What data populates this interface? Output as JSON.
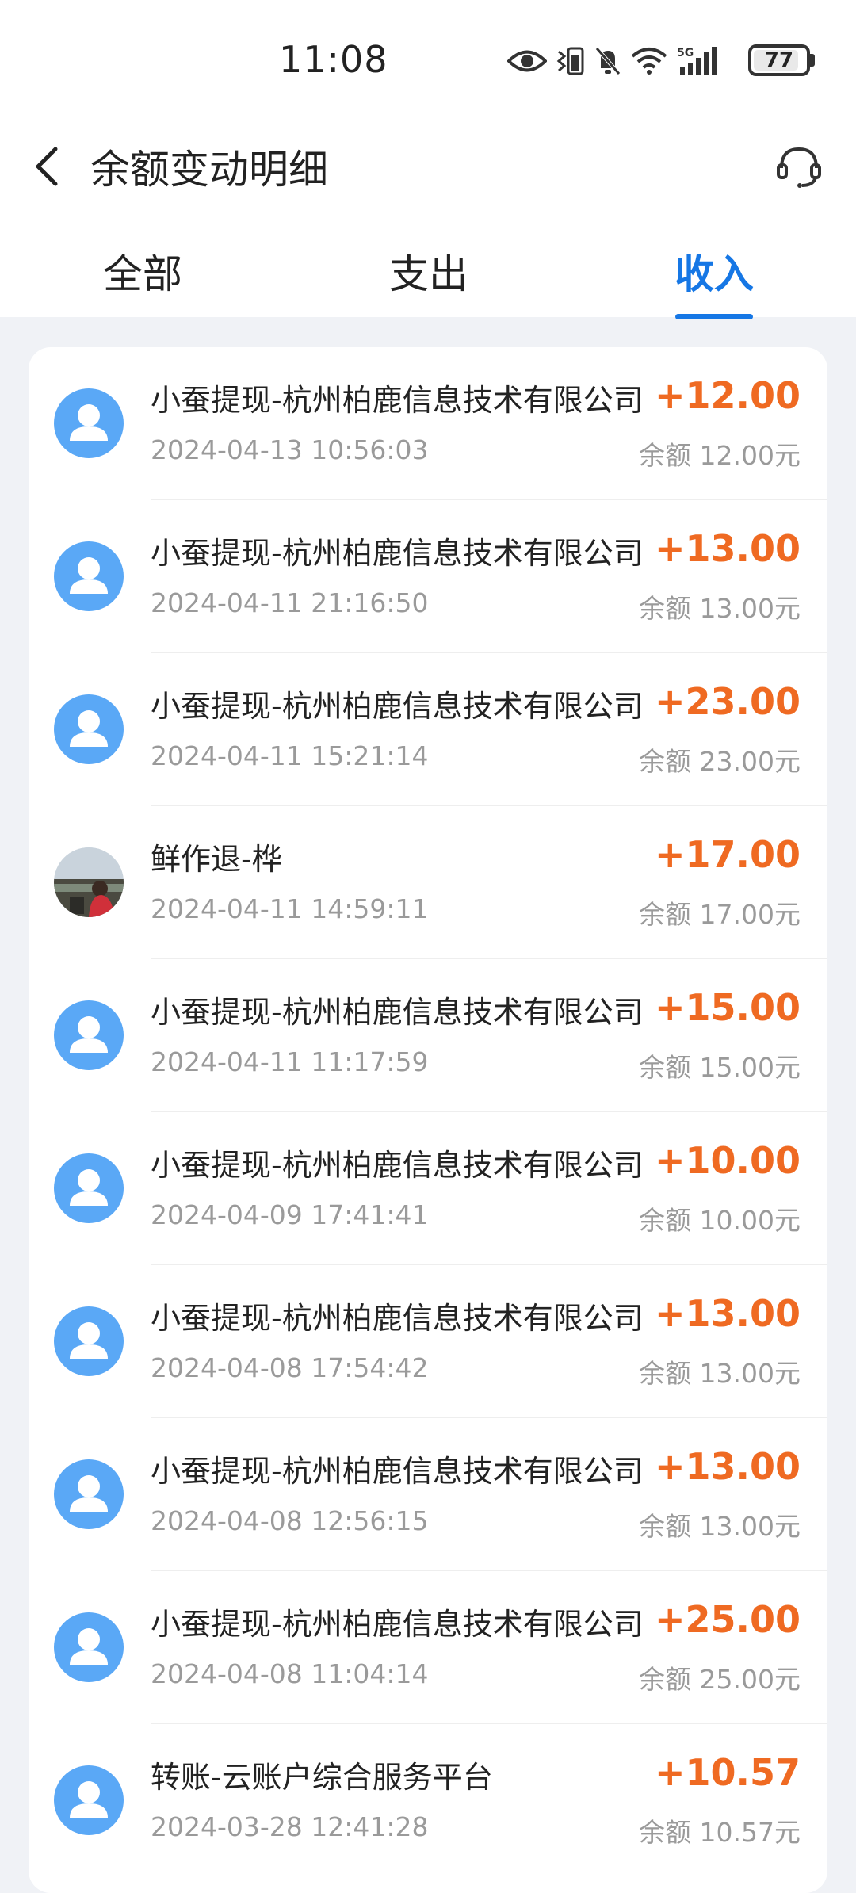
{
  "status_bar": {
    "time": "11:08",
    "battery": "77",
    "icons": [
      "eye-icon",
      "vibrate-battery-icon",
      "mute-bell-icon",
      "wifi-icon",
      "5g-signal-icon"
    ]
  },
  "header": {
    "title": "余额变动明细",
    "back_icon": "chevron-left-icon",
    "service_icon": "customer-service-icon"
  },
  "tabs": [
    {
      "label": "全部",
      "active": false
    },
    {
      "label": "支出",
      "active": false
    },
    {
      "label": "收入",
      "active": true
    }
  ],
  "colors": {
    "accent": "#1677e5",
    "amount": "#ef6a22",
    "avatar": "#5aa8f6",
    "background": "#f0f2f6"
  },
  "transactions": [
    {
      "title": "小蚕提现-杭州柏鹿信息技术有限公司",
      "date": "2024-04-13 10:56:03",
      "amount": "+12.00",
      "balance": "余额 12.00元",
      "avatar": "default"
    },
    {
      "title": "小蚕提现-杭州柏鹿信息技术有限公司",
      "date": "2024-04-11 21:16:50",
      "amount": "+13.00",
      "balance": "余额 13.00元",
      "avatar": "default"
    },
    {
      "title": "小蚕提现-杭州柏鹿信息技术有限公司",
      "date": "2024-04-11 15:21:14",
      "amount": "+23.00",
      "balance": "余额 23.00元",
      "avatar": "default"
    },
    {
      "title": "鲜作退-桦",
      "date": "2024-04-11 14:59:11",
      "amount": "+17.00",
      "balance": "余额 17.00元",
      "avatar": "photo"
    },
    {
      "title": "小蚕提现-杭州柏鹿信息技术有限公司",
      "date": "2024-04-11 11:17:59",
      "amount": "+15.00",
      "balance": "余额 15.00元",
      "avatar": "default"
    },
    {
      "title": "小蚕提现-杭州柏鹿信息技术有限公司",
      "date": "2024-04-09 17:41:41",
      "amount": "+10.00",
      "balance": "余额 10.00元",
      "avatar": "default"
    },
    {
      "title": "小蚕提现-杭州柏鹿信息技术有限公司",
      "date": "2024-04-08 17:54:42",
      "amount": "+13.00",
      "balance": "余额 13.00元",
      "avatar": "default"
    },
    {
      "title": "小蚕提现-杭州柏鹿信息技术有限公司",
      "date": "2024-04-08 12:56:15",
      "amount": "+13.00",
      "balance": "余额 13.00元",
      "avatar": "default"
    },
    {
      "title": "小蚕提现-杭州柏鹿信息技术有限公司",
      "date": "2024-04-08 11:04:14",
      "amount": "+25.00",
      "balance": "余额 25.00元",
      "avatar": "default"
    },
    {
      "title": "转账-云账户综合服务平台",
      "date": "2024-03-28 12:41:28",
      "amount": "+10.57",
      "balance": "余额 10.57元",
      "avatar": "default"
    }
  ]
}
